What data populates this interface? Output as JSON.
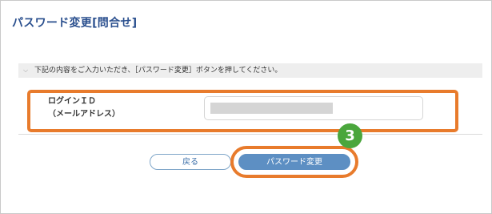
{
  "page": {
    "title": "パスワード変更[問合せ]",
    "notice": "下記の内容をご入力いただき、［パスワード変更］ボタンを押してください。"
  },
  "form": {
    "login_label_line1": "ログインＩＤ",
    "login_label_line2": "（メールアドレス）",
    "login_value": ""
  },
  "buttons": {
    "back": "戻る",
    "submit": "パスワード変更"
  },
  "annotation": {
    "step_number": "3",
    "highlight_color": "#e87b2c",
    "badge_color": "#4aa63c"
  },
  "colors": {
    "title": "#2a4f8e",
    "submit_bg": "#5d8fc3"
  }
}
